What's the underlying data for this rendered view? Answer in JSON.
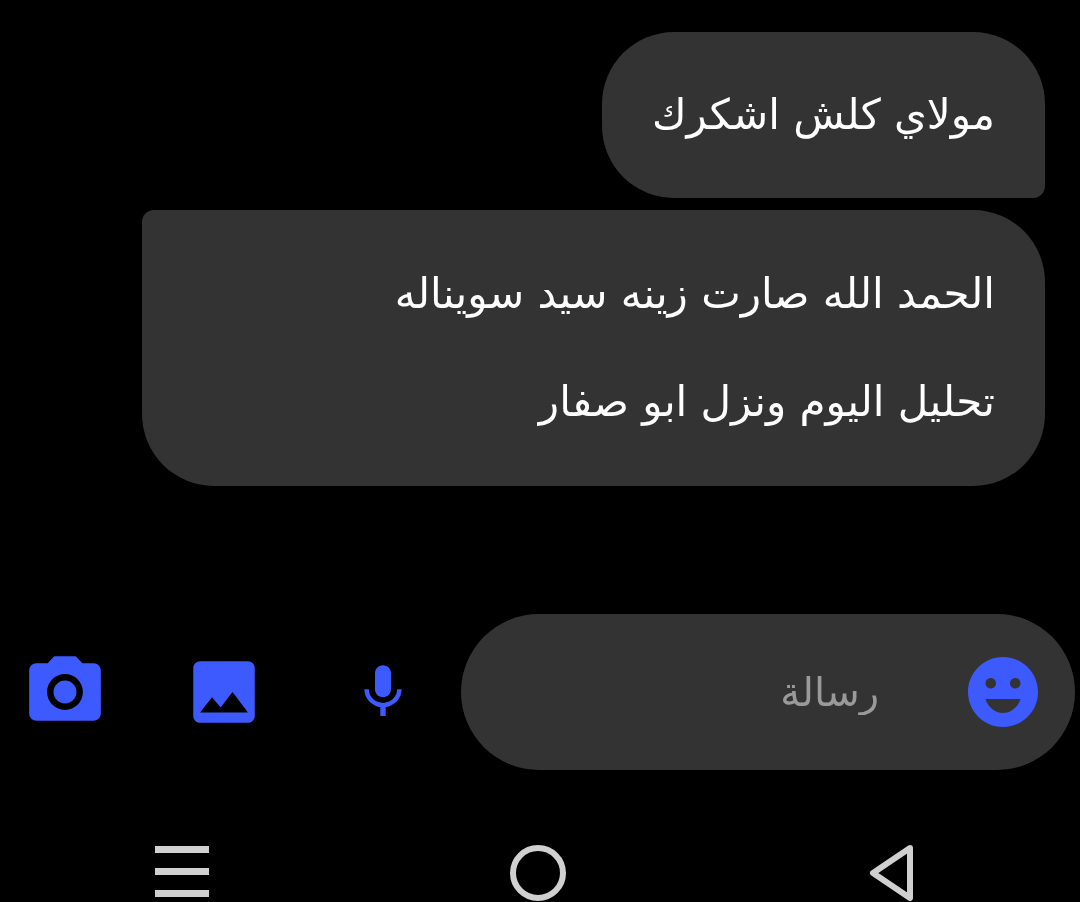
{
  "messages": [
    {
      "text": "مولاي كلش اشكرك"
    },
    {
      "text": "الحمد الله صارت زينه سيد سويناله\nتحليل اليوم ونزل ابو صفار"
    }
  ],
  "composer": {
    "placeholder": "رسالة"
  }
}
